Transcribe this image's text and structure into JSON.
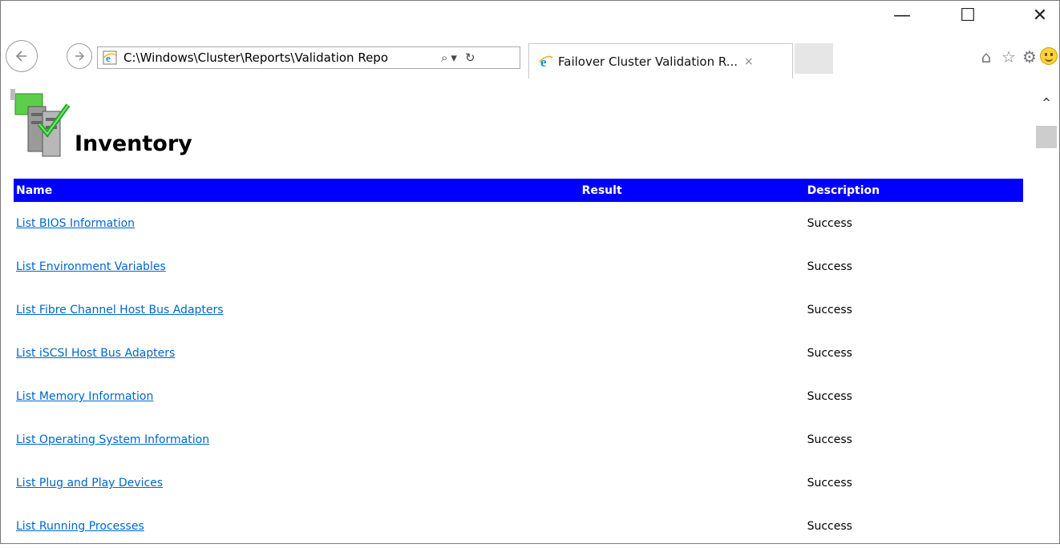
{
  "window": {
    "controls": {
      "minimize": "—",
      "maximize": "☐",
      "close": "✕"
    }
  },
  "toolbar": {
    "back_icon": "back-arrow-icon",
    "forward_icon": "forward-arrow-icon",
    "address": "C:\\Windows\\Cluster\\Reports\\Validation Repo",
    "search_icon": "⌕",
    "dropdown_icon": "▾",
    "refresh_icon": "↻",
    "home_icon": "⌂",
    "favorites_icon": "☆",
    "settings_icon": "⚙",
    "feedback_icon": "smiley-icon"
  },
  "tab": {
    "title": "Failover Cluster Validation R...",
    "close": "×"
  },
  "page": {
    "title": "Inventory",
    "columns": {
      "name": "Name",
      "result": "Result",
      "description": "Description"
    },
    "rows": [
      {
        "name": "List BIOS Information",
        "result": "",
        "description": "Success"
      },
      {
        "name": "List Environment Variables",
        "result": "",
        "description": "Success"
      },
      {
        "name": "List Fibre Channel Host Bus Adapters",
        "result": "",
        "description": "Success"
      },
      {
        "name": "List iSCSI Host Bus Adapters",
        "result": "",
        "description": "Success"
      },
      {
        "name": "List Memory Information",
        "result": "",
        "description": "Success"
      },
      {
        "name": "List Operating System Information",
        "result": "",
        "description": "Success"
      },
      {
        "name": "List Plug and Play Devices",
        "result": "",
        "description": "Success"
      },
      {
        "name": "List Running Processes",
        "result": "",
        "description": "Success"
      }
    ]
  },
  "colors": {
    "header_bg": "#0000ff",
    "link": "#0066cc",
    "ie_blue": "#1e8ad6",
    "ie_gold": "#f3b31b"
  }
}
